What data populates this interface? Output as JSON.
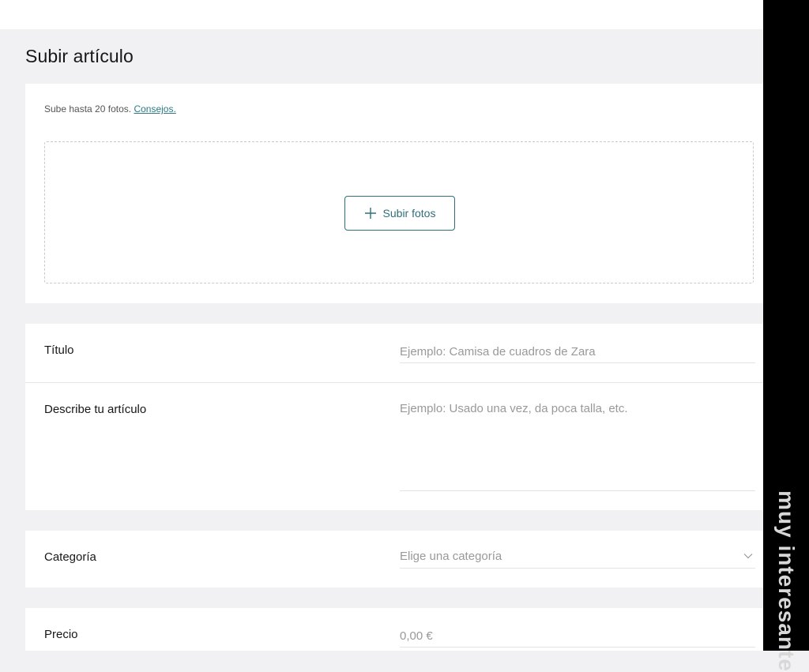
{
  "page": {
    "title": "Subir artículo"
  },
  "photos": {
    "hint": "Sube hasta 20 fotos.",
    "tips_link": "Consejos.",
    "upload_button": "Subir fotos",
    "upload_icon": "plus-icon"
  },
  "form": {
    "title": {
      "label": "Título",
      "value": "",
      "placeholder": "Ejemplo: Camisa de cuadros de Zara"
    },
    "description": {
      "label": "Describe tu artículo",
      "value": "",
      "placeholder": "Ejemplo: Usado una vez, da poca talla, etc."
    },
    "category": {
      "label": "Categoría",
      "selected": "Elige una categoría",
      "icon": "chevron-down-icon"
    },
    "price": {
      "label": "Precio",
      "value": "",
      "placeholder": "0,00 €"
    }
  },
  "watermark": {
    "text": "muy interesante"
  },
  "colors": {
    "accent": "#2e6f7a",
    "background": "#f1f1f3",
    "card": "#ffffff",
    "sidebar": "#000000"
  }
}
